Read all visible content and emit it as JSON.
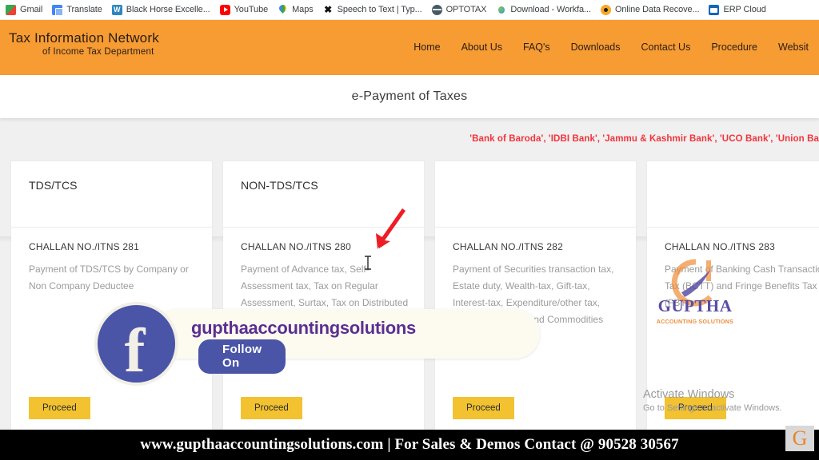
{
  "browser": {
    "bookmarks": [
      {
        "label": "Gmail",
        "icon": "gmail-icon"
      },
      {
        "label": "Translate",
        "icon": "translate-icon"
      },
      {
        "label": "Black Horse Excelle...",
        "icon": "wordpress-icon"
      },
      {
        "label": "YouTube",
        "icon": "youtube-icon"
      },
      {
        "label": "Maps",
        "icon": "maps-pin-icon"
      },
      {
        "label": "Speech to Text | Typ...",
        "icon": "speech-to-text-icon"
      },
      {
        "label": "OPTOTAX",
        "icon": "globe-icon"
      },
      {
        "label": "Download - Workfa...",
        "icon": "download-icon"
      },
      {
        "label": "Online Data Recove...",
        "icon": "disc-icon"
      },
      {
        "label": "ERP Cloud",
        "icon": "erp-cloud-icon"
      }
    ]
  },
  "site": {
    "brand_main": "Tax Information Network",
    "brand_sub": "of Income Tax Department",
    "header_color": "#f79b33",
    "nav": [
      {
        "label": "Home"
      },
      {
        "label": "About Us"
      },
      {
        "label": "FAQ's"
      },
      {
        "label": "Downloads"
      },
      {
        "label": "Contact Us"
      },
      {
        "label": "Procedure"
      },
      {
        "label": "Websit"
      }
    ],
    "page_title": "e-Payment of Taxes",
    "marquee": "'Bank of Baroda', 'IDBI Bank', 'Jammu & Kashmir Bank', 'UCO Bank', 'Union Ba",
    "marquee_color": "#f0343b"
  },
  "cards": [
    {
      "heading": "TDS/TCS",
      "challan_no": "CHALLAN NO./ITNS 281",
      "description": "Payment of TDS/TCS by Company or Non Company Deductee",
      "proceed_label": "Proceed"
    },
    {
      "heading": "NON-TDS/TCS",
      "challan_no": "CHALLAN NO./ITNS 280",
      "description": "Payment of Advance tax, Self-Assessment tax, Tax on Regular Assessment, Surtax, Tax on Distributed Profits of Domestic Company and Tax on Distributed income to unit holders.",
      "proceed_label": "Proceed"
    },
    {
      "heading": "",
      "challan_no": "CHALLAN NO./ITNS 282",
      "description": "Payment of Securities transaction tax, Estate duty, Wealth-tax, Gift-tax, Interest-tax, Expenditure/other tax, Hotel Receipt tax and Commodities transaction tax",
      "proceed_label": "Proceed"
    },
    {
      "heading": "",
      "challan_no": "CHALLAN NO./ITNS 283",
      "description": "Payment of Banking Cash Transaction Tax (BCTT) and Fringe Benefits Tax (FBT)",
      "proceed_label": "Proceed"
    }
  ],
  "overlays": {
    "facebook": {
      "handle": "gupthaaccountingsolutions",
      "follow_label": "Follow On",
      "icon": "facebook-f-icon",
      "brand_color": "#4a55a8"
    },
    "watermark_logo": {
      "name": "GUPTHA",
      "tagline": "ACCOUNTING SOLUTIONS",
      "name_color": "#4b3f9e",
      "tagline_color": "#e8842a"
    },
    "windows_activation": {
      "title": "Activate Windows",
      "subtitle": "Go to Settings to activate Windows."
    },
    "annotation": {
      "arrow": "red-down-left-arrow",
      "arrow_color": "#ee1c25",
      "cursor": "text-ibeam-cursor"
    }
  },
  "bottom_banner": {
    "text": "www.gupthaaccountingsolutions.com | For Sales & Demos Contact @ 90528 30567",
    "background": "#000000",
    "logo_letter": "G"
  }
}
